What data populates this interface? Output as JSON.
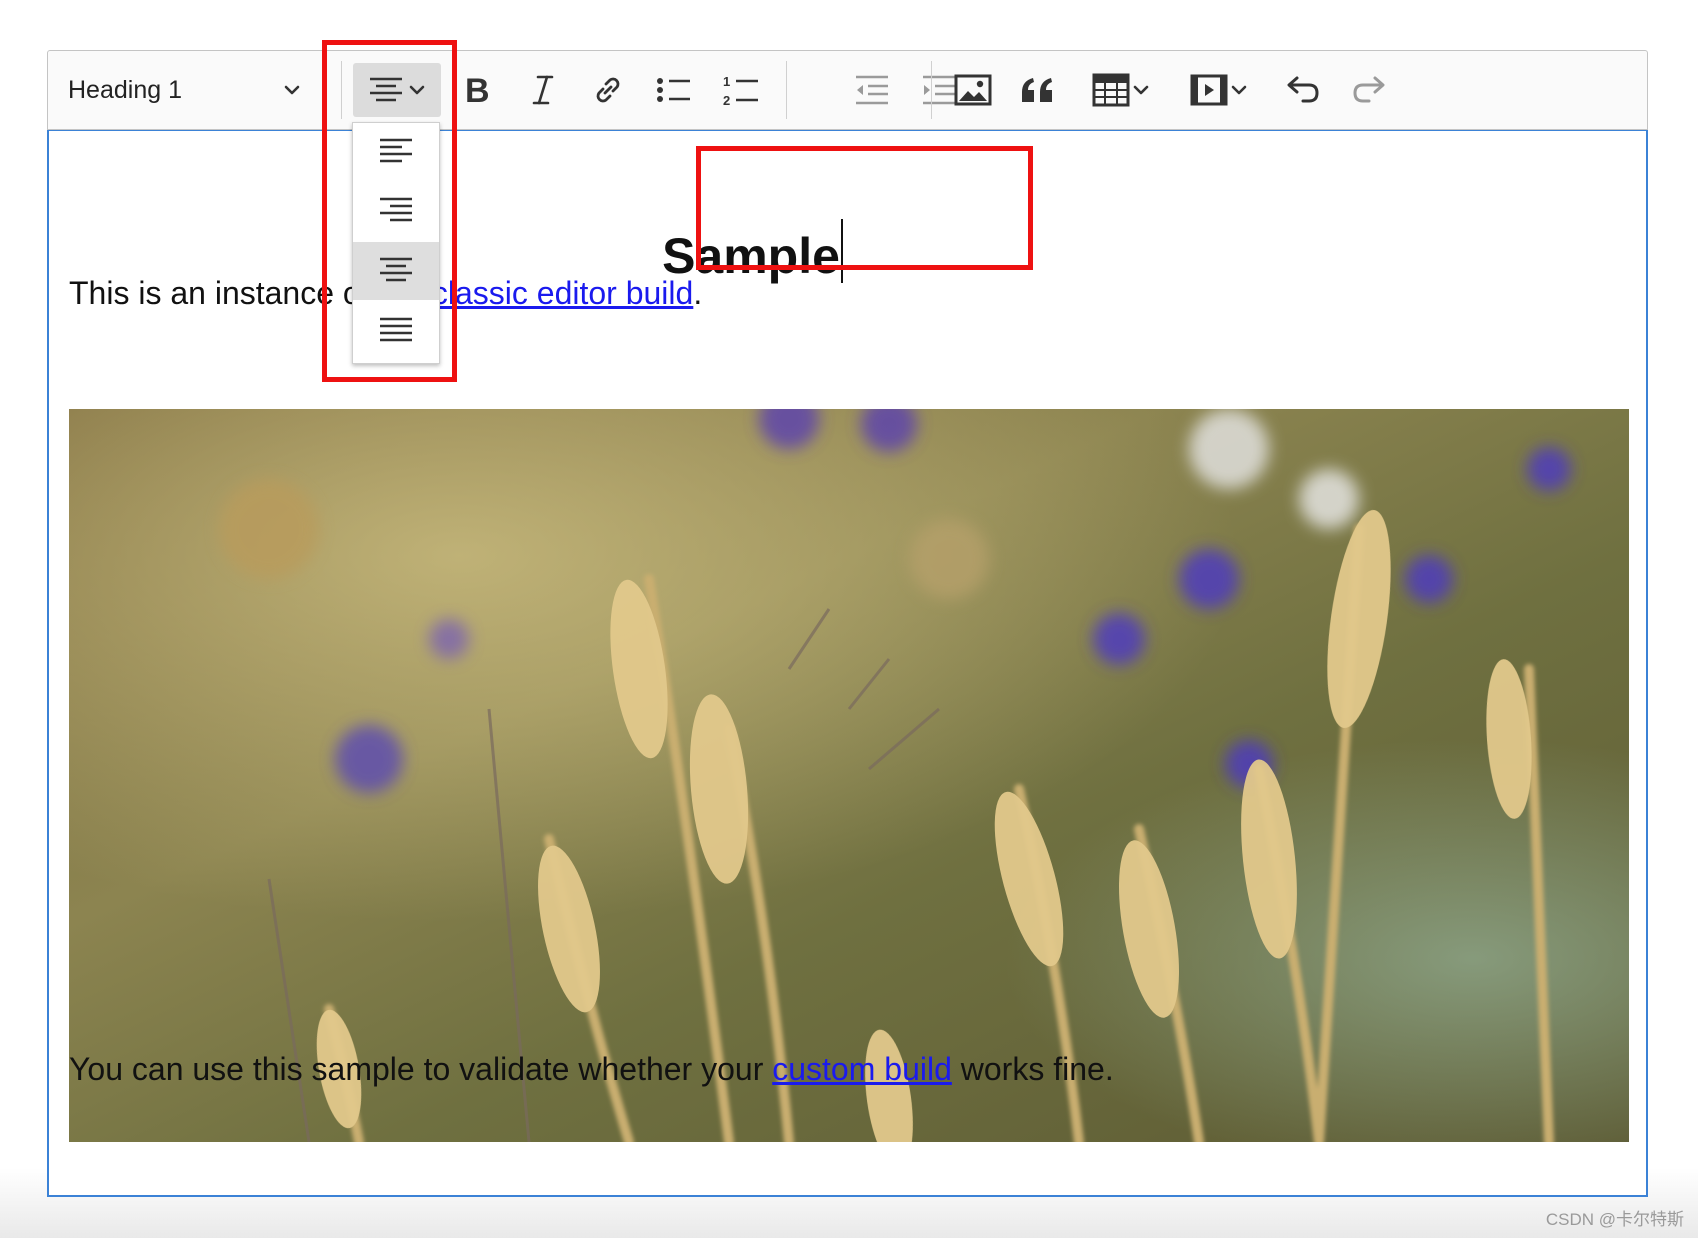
{
  "toolbar": {
    "heading_dropdown": {
      "selected": "Heading 1",
      "icon": "chevron-down-icon"
    },
    "buttons": [
      {
        "name": "alignment-button",
        "icon": "align-center-icon",
        "active": true
      },
      {
        "name": "bold-button",
        "icon": "bold-icon"
      },
      {
        "name": "italic-button",
        "icon": "italic-icon"
      },
      {
        "name": "link-button",
        "icon": "link-icon"
      },
      {
        "name": "bulleted-list-button",
        "icon": "bulleted-list-icon"
      },
      {
        "name": "numbered-list-button",
        "icon": "numbered-list-icon"
      },
      {
        "name": "outdent-button",
        "icon": "outdent-icon",
        "disabled": true
      },
      {
        "name": "indent-button",
        "icon": "indent-icon",
        "disabled": true
      },
      {
        "name": "insert-image-button",
        "icon": "image-icon"
      },
      {
        "name": "block-quote-button",
        "icon": "quote-icon"
      },
      {
        "name": "insert-table-button",
        "icon": "table-icon"
      },
      {
        "name": "insert-media-button",
        "icon": "media-icon"
      },
      {
        "name": "undo-button",
        "icon": "undo-icon"
      },
      {
        "name": "redo-button",
        "icon": "redo-icon",
        "disabled": true
      }
    ]
  },
  "alignment_dropdown": {
    "options": [
      {
        "name": "align-left",
        "icon": "align-left-icon"
      },
      {
        "name": "align-right",
        "icon": "align-right-icon"
      },
      {
        "name": "align-center",
        "icon": "align-center-icon",
        "selected": true
      },
      {
        "name": "align-justify",
        "icon": "align-justify-icon"
      }
    ]
  },
  "content": {
    "heading": "Sample",
    "paragraph1": {
      "before": "This is an instance of the ",
      "link": "classic editor build",
      "after": "."
    },
    "image": {
      "alt": "wheat field"
    },
    "paragraph2": {
      "before": "You can use this sample to validate whether your ",
      "link": "custom build",
      "after": " works fine."
    }
  },
  "annotation_color": "#ee1111",
  "focus_border_color": "#3b82d6",
  "link_color": "#1a1aee",
  "watermark": "CSDN @卡尔特斯"
}
